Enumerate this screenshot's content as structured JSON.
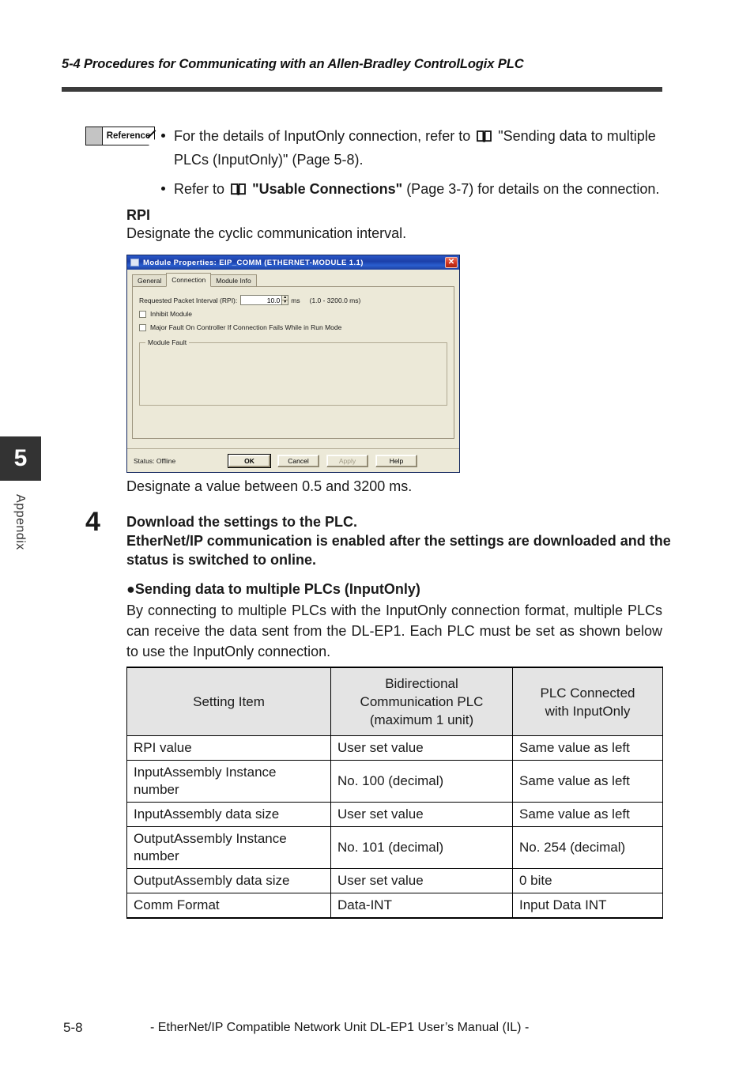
{
  "header": {
    "running_title": "5-4 Procedures for Communicating with an Allen-Bradley ControlLogix PLC"
  },
  "side_tab": {
    "chapter_number": "5",
    "label": "Appendix"
  },
  "reference": {
    "badge_label": "Reference",
    "bullets": [
      {
        "pre": "For the details of InputOnly connection, refer to",
        "icon": "book-icon",
        "quote": "\"Sending data to multiple PLCs (InputOnly)\"",
        "post": "(Page 5-8)."
      },
      {
        "pre": "Refer to",
        "icon": "book-icon",
        "quote": "\"Usable Connections\"",
        "post": "(Page 3-7) for details on the connection."
      }
    ]
  },
  "rpi_section": {
    "heading": "RPI",
    "description": "Designate the cyclic communication interval.",
    "caption": "Designate a value between 0.5 and 3200 ms."
  },
  "dialog": {
    "title": "Module Properties: EIP_COMM (ETHERNET-MODULE 1.1)",
    "close_label": "✕",
    "tabs": [
      {
        "label": "General",
        "active": false
      },
      {
        "label": "Connection",
        "active": true
      },
      {
        "label": "Module Info",
        "active": false
      }
    ],
    "rpi_field": {
      "label": "Requested Packet Interval (RPI):",
      "value": "10.0",
      "unit": "ms",
      "range": "(1.0 - 3200.0 ms)",
      "spin_up": "▲",
      "spin_down": "▼"
    },
    "checkboxes": [
      {
        "label": "Inhibit Module",
        "checked": false
      },
      {
        "label": "Major Fault On Controller If Connection Fails While in Run Mode",
        "checked": false
      }
    ],
    "groupbox": {
      "legend": "Module Fault",
      "content": ""
    },
    "status": "Status: Offline",
    "buttons": [
      {
        "label": "OK",
        "state": "default"
      },
      {
        "label": "Cancel",
        "state": "normal"
      },
      {
        "label": "Apply",
        "state": "disabled"
      },
      {
        "label": "Help",
        "state": "normal"
      }
    ]
  },
  "step4": {
    "number": "4",
    "line1": "Download the settings to the PLC.",
    "line2": "EtherNet/IP communication is enabled after the settings are downloaded and the status is switched to online."
  },
  "multi_plc_section": {
    "heading": "●Sending data to multiple PLCs (InputOnly)",
    "body": "By connecting to multiple PLCs with the InputOnly connection format, multiple PLCs can receive the data sent from the DL-EP1. Each PLC must be set as shown below to use the InputOnly connection."
  },
  "table": {
    "headers": [
      "Setting Item",
      "Bidirectional\nCommunication PLC\n(maximum 1 unit)",
      "PLC Connected\nwith InputOnly"
    ],
    "headers_lines": [
      [
        "Setting Item"
      ],
      [
        "Bidirectional",
        "Communication PLC",
        "(maximum 1 unit)"
      ],
      [
        "PLC Connected",
        "with InputOnly"
      ]
    ],
    "rows": [
      {
        "item": "RPI value",
        "bidirectional": "User set value",
        "inputonly": "Same value as left"
      },
      {
        "item": "InputAssembly Instance number",
        "bidirectional": "No. 100 (decimal)",
        "inputonly": "Same value as left"
      },
      {
        "item": "InputAssembly data size",
        "bidirectional": "User set value",
        "inputonly": "Same value as left"
      },
      {
        "item": "OutputAssembly Instance number",
        "bidirectional": "No. 101 (decimal)",
        "inputonly": "No. 254 (decimal)"
      },
      {
        "item": "OutputAssembly data size",
        "bidirectional": "User set value",
        "inputonly": "0 bite"
      },
      {
        "item": "Comm Format",
        "bidirectional": "Data-INT",
        "inputonly": "Input Data INT"
      }
    ]
  },
  "footer": {
    "page_number": "5-8",
    "manual_title": "- EtherNet/IP Compatible Network Unit DL-EP1 User’s Manual (IL) -"
  }
}
